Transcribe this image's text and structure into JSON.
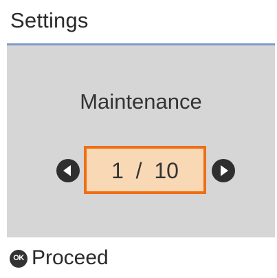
{
  "header": {
    "title": "Settings"
  },
  "main": {
    "title": "Maintenance",
    "pager": {
      "current": "1",
      "separator": "/",
      "total": "10",
      "display": "1  /  10"
    }
  },
  "footer": {
    "ok_label": "OK",
    "action_label": "Proceed"
  },
  "colors": {
    "header_divider": "#7d9bc4",
    "panel_background": "#d6d6d6",
    "selection_border": "#ee6e15",
    "selection_fill": "#f8d8b5"
  },
  "icons": {
    "previous": "arrow-left-icon",
    "next": "arrow-right-icon",
    "confirm": "ok-button-icon"
  }
}
